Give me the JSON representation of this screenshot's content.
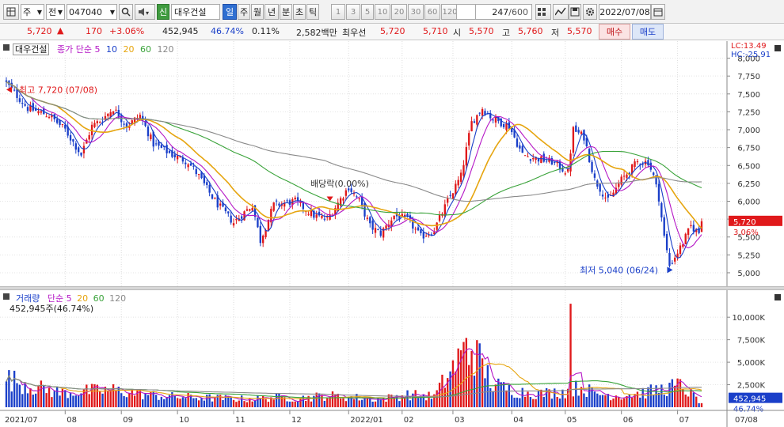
{
  "toolbar": {
    "market": "주",
    "type": "전",
    "code": "047040",
    "sin": "신",
    "stock_name": "대우건설",
    "periods": [
      "일",
      "주",
      "월",
      "년",
      "분",
      "초",
      "틱"
    ],
    "active_period": "일",
    "minutes": [
      "1",
      "3",
      "5",
      "10",
      "20",
      "30",
      "60",
      "120"
    ],
    "count": "247",
    "count_total": "/600",
    "date": "2022/07/08"
  },
  "quote": {
    "price": "5,720",
    "change": "170",
    "change_pct": "+3.06%",
    "volume": "452,945",
    "vol_ratio": "46.74%",
    "turnover": "0.11%",
    "amount": "2,582백만",
    "best_label": "최우선",
    "best_ask": "5,720",
    "best_bid": "5,710",
    "open_label": "시",
    "open": "5,570",
    "high_label": "고",
    "high": "5,760",
    "low_label": "저",
    "low": "5,570",
    "buy": "매수",
    "sell": "매도"
  },
  "price_pane": {
    "name": "대우건설",
    "legend": [
      "종가 단순 5",
      "10",
      "20",
      "60",
      "120"
    ],
    "lc": "LC:13.49",
    "hc": "HC:-25.91",
    "y_ticks": [
      "8,000",
      "7,750",
      "7,500",
      "7,250",
      "7,000",
      "6,750",
      "6,500",
      "6,250",
      "6,000",
      "5,750",
      "5,500",
      "5,250",
      "5,000"
    ],
    "price_tag": "5,720",
    "price_tag_pct": "3.06%",
    "high_note": "최고 7,720 (07/08)",
    "low_note": "최저 5,040 (06/24)",
    "dividend_note": "배당락(0.00%)"
  },
  "volume_pane": {
    "title": "거래량",
    "legend": [
      "단순 5",
      "20",
      "60",
      "120"
    ],
    "info": "452,945주(46.74%)",
    "y_ticks": [
      "10,000K",
      "7,500K",
      "5,000K",
      "2,500K"
    ],
    "vol_tag": "452,945",
    "vol_tag_pct": "46.74%"
  },
  "x_axis": [
    "2021/07",
    "08",
    "09",
    "10",
    "11",
    "12",
    "2022/01",
    "02",
    "03",
    "04",
    "05",
    "06",
    "07",
    "07/08"
  ],
  "colors": {
    "up": "#e0191b",
    "down": "#1a3fc9",
    "ma5": "#1a3fc9",
    "ma10": "#b517c6",
    "ma20": "#e6a50f",
    "ma60": "#3aa33a",
    "ma120": "#8a8a8a"
  },
  "chart_data": {
    "type": "candlestick",
    "y_range": [
      4900,
      8150
    ],
    "close_anchors": [
      [
        0,
        7650
      ],
      [
        8,
        7300
      ],
      [
        16,
        7200
      ],
      [
        22,
        7000
      ],
      [
        28,
        6650
      ],
      [
        32,
        7050
      ],
      [
        36,
        7150
      ],
      [
        40,
        7300
      ],
      [
        45,
        7050
      ],
      [
        50,
        7200
      ],
      [
        55,
        6800
      ],
      [
        62,
        6650
      ],
      [
        68,
        6550
      ],
      [
        72,
        6350
      ],
      [
        78,
        6000
      ],
      [
        85,
        5700
      ],
      [
        92,
        5950
      ],
      [
        95,
        5450
      ],
      [
        100,
        5950
      ],
      [
        108,
        6000
      ],
      [
        115,
        5800
      ],
      [
        120,
        5750
      ],
      [
        128,
        6200
      ],
      [
        132,
        6000
      ],
      [
        136,
        5650
      ],
      [
        140,
        5550
      ],
      [
        145,
        5800
      ],
      [
        150,
        5750
      ],
      [
        155,
        5500
      ],
      [
        160,
        5600
      ],
      [
        165,
        6000
      ],
      [
        170,
        6350
      ],
      [
        174,
        7100
      ],
      [
        178,
        7300
      ],
      [
        182,
        7150
      ],
      [
        188,
        7050
      ],
      [
        193,
        6650
      ],
      [
        198,
        6600
      ],
      [
        204,
        6550
      ],
      [
        210,
        6400
      ],
      [
        212,
        7000
      ],
      [
        216,
        6900
      ],
      [
        220,
        6300
      ],
      [
        225,
        6000
      ],
      [
        230,
        6300
      ],
      [
        236,
        6550
      ],
      [
        240,
        6550
      ],
      [
        242,
        6350
      ],
      [
        244,
        6050
      ],
      [
        246,
        5500
      ],
      [
        248,
        5100
      ],
      [
        252,
        5350
      ],
      [
        256,
        5650
      ],
      [
        259,
        5560
      ],
      [
        260,
        5720
      ]
    ],
    "volume_anchors_k": [
      [
        0,
        3200
      ],
      [
        10,
        2300
      ],
      [
        20,
        1600
      ],
      [
        30,
        1800
      ],
      [
        40,
        1900
      ],
      [
        50,
        1500
      ],
      [
        60,
        1200
      ],
      [
        70,
        1100
      ],
      [
        80,
        1000
      ],
      [
        90,
        900
      ],
      [
        100,
        1100
      ],
      [
        110,
        1000
      ],
      [
        120,
        1300
      ],
      [
        130,
        1100
      ],
      [
        140,
        900
      ],
      [
        150,
        1400
      ],
      [
        160,
        1200
      ],
      [
        165,
        3500
      ],
      [
        170,
        5700
      ],
      [
        174,
        6500
      ],
      [
        178,
        4700
      ],
      [
        182,
        2500
      ],
      [
        190,
        1800
      ],
      [
        200,
        1500
      ],
      [
        210,
        1800
      ],
      [
        215,
        2300
      ],
      [
        220,
        1500
      ],
      [
        230,
        1300
      ],
      [
        240,
        1700
      ],
      [
        248,
        2200
      ],
      [
        252,
        2400
      ],
      [
        256,
        1500
      ],
      [
        260,
        453
      ]
    ],
    "volume_spike_k": [
      [
        211,
        11500
      ],
      [
        172,
        7700
      ]
    ],
    "volume_range_k": [
      0,
      12300
    ]
  }
}
